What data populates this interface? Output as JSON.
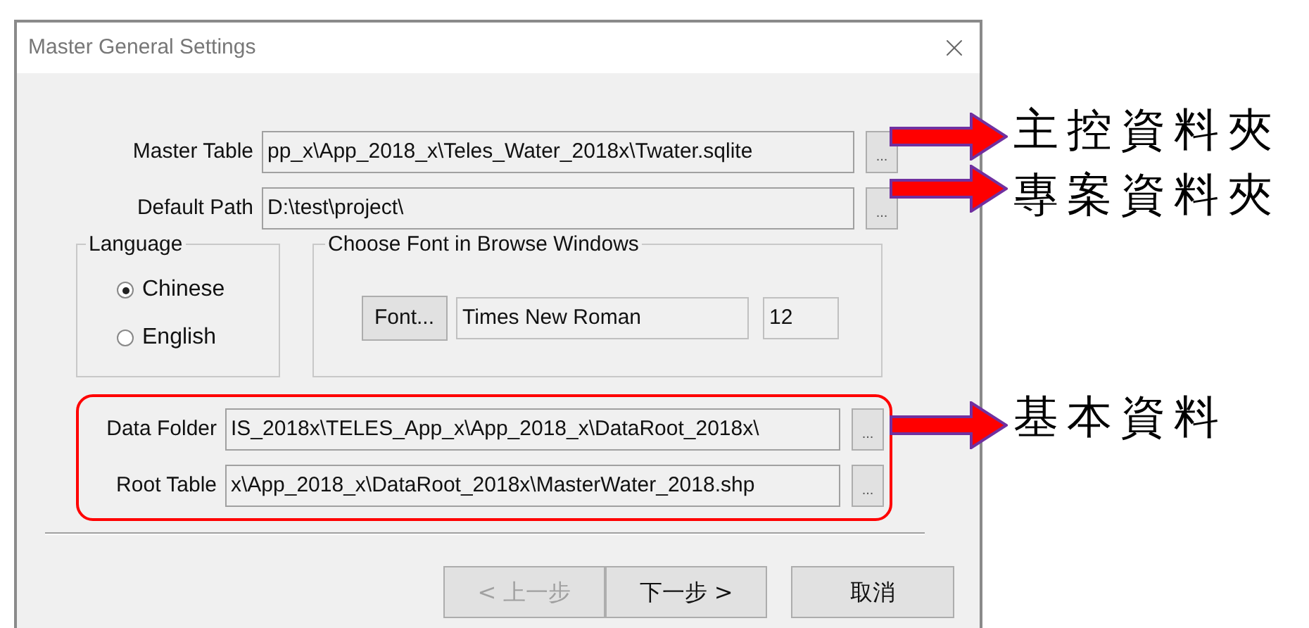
{
  "window": {
    "title": "Master General Settings"
  },
  "paths": [
    {
      "label": "Master Table",
      "value": "pp_x\\App_2018_x\\Teles_Water_2018x\\Twater.sqlite",
      "browse": "..."
    },
    {
      "label": "Default Path",
      "value": "D:\\test\\project\\",
      "browse": "..."
    }
  ],
  "language": {
    "title": "Language",
    "options": [
      {
        "label": "Chinese",
        "selected": true
      },
      {
        "label": "English",
        "selected": false
      }
    ]
  },
  "font_group": {
    "title": "Choose Font in Browse Windows",
    "button": "Font...",
    "font_name": "Times New Roman",
    "font_size": "12"
  },
  "data_rows": [
    {
      "label": "Data Folder",
      "value": "IS_2018x\\TELES_App_x\\App_2018_x\\DataRoot_2018x\\",
      "browse": "..."
    },
    {
      "label": "Root Table",
      "value": "x\\App_2018_x\\DataRoot_2018x\\MasterWater_2018.shp",
      "browse": "..."
    }
  ],
  "buttons": [
    {
      "label": "< 上一步",
      "disabled": true
    },
    {
      "label": "下一步 >",
      "disabled": false
    },
    {
      "label": "取消",
      "disabled": false
    }
  ],
  "annotations": [
    {
      "text": "主控資料夾"
    },
    {
      "text": "專案資料夾"
    },
    {
      "text": "基本資料"
    }
  ]
}
